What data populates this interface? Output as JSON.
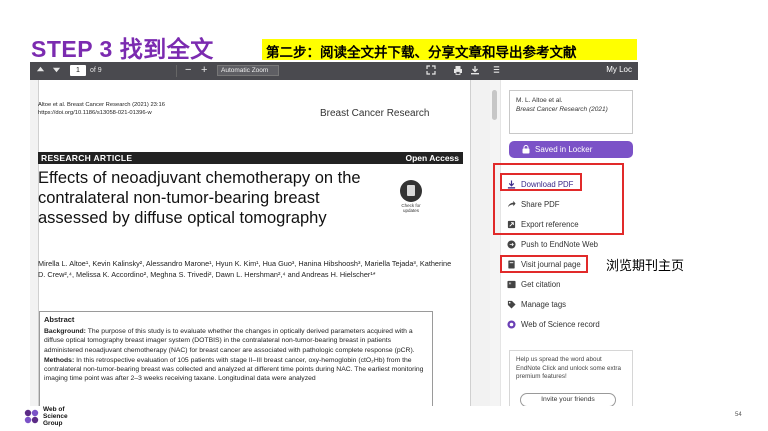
{
  "slide": {
    "step_title": "STEP 3  找到全文",
    "step_subtitle": "第二步：阅读全文并下载、分享文章和导出参考文献",
    "annotation": "浏览期刊主页",
    "page_number": "54"
  },
  "logo": {
    "line1": "Web of",
    "line2": "Science",
    "line3": "Group"
  },
  "toolbar": {
    "page_current": "1",
    "page_total": "of 9",
    "zoom": "Automatic Zoom",
    "account_label": "My Loc"
  },
  "pdf": {
    "citation_line1": "Altoe et al. Breast Cancer Research        (2021) 23:16",
    "citation_line2": "https://doi.org/10.1186/s13058-021-01396-w",
    "journal_name": "Breast Cancer Research",
    "article_type": "RESEARCH ARTICLE",
    "access_label": "Open Access",
    "title": "Effects of neoadjuvant chemotherapy on the contralateral non-tumor-bearing breast assessed by diffuse optical tomography",
    "check_updates": "Check for updates",
    "authors": "Mirella L. Altoe¹, Kevin Kalinsky², Alessandro Marone¹, Hyun K. Kim¹, Hua Guo³, Hanina Hibshoosh³, Mariella Tejada³, Katherine D. Crew²,⁴, Melissa K. Accordino², Meghna S. Trivedi², Dawn L. Hershman²,⁴ and Andreas H. Hielscher¹*",
    "abstract_heading": "Abstract",
    "background_label": "Background:",
    "background_text": "The purpose of this study is to evaluate whether the changes in optically derived parameters acquired with a diffuse optical tomography breast imager system (DOTBIS) in the contralateral non-tumor-bearing breast in patients administered neoadjuvant chemotherapy (NAC) for breast cancer are associated with pathologic complete response (pCR).",
    "methods_label": "Methods:",
    "methods_text": "In this retrospective evaluation of 105 patients with stage II–III breast cancer, oxy-hemoglobin (ctO₂Hb) from the contralateral non-tumor-bearing breast was collected and analyzed at different time points during NAC. The earliest monitoring imaging time point was after 2–3 weeks receiving taxane. Longitudinal data were analyzed"
  },
  "panel": {
    "cite_author": "M. L. Altoe et al.",
    "cite_source": "Breast Cancer Research  (2021)",
    "saved_label": "Saved in Locker",
    "actions": [
      {
        "label": "Download PDF",
        "icon": "download-icon"
      },
      {
        "label": "Share PDF",
        "icon": "share-icon"
      },
      {
        "label": "Export reference",
        "icon": "export-icon"
      },
      {
        "label": "Push to EndNote Web",
        "icon": "endnote-icon"
      },
      {
        "label": "Visit journal page",
        "icon": "journal-icon"
      },
      {
        "label": "Get citation",
        "icon": "quote-icon"
      },
      {
        "label": "Manage tags",
        "icon": "tag-icon"
      },
      {
        "label": "Web of Science record",
        "icon": "wos-icon"
      }
    ],
    "help_text": "Help us spread the word about EndNote Click and unlock some extra premium features!",
    "invite_label": "Invite your friends"
  },
  "colors": {
    "title_purple": "#7b2bb0",
    "highlight_yellow": "#ffff00",
    "annotation_red": "#e12a2a",
    "button_purple": "#7b52c7"
  }
}
